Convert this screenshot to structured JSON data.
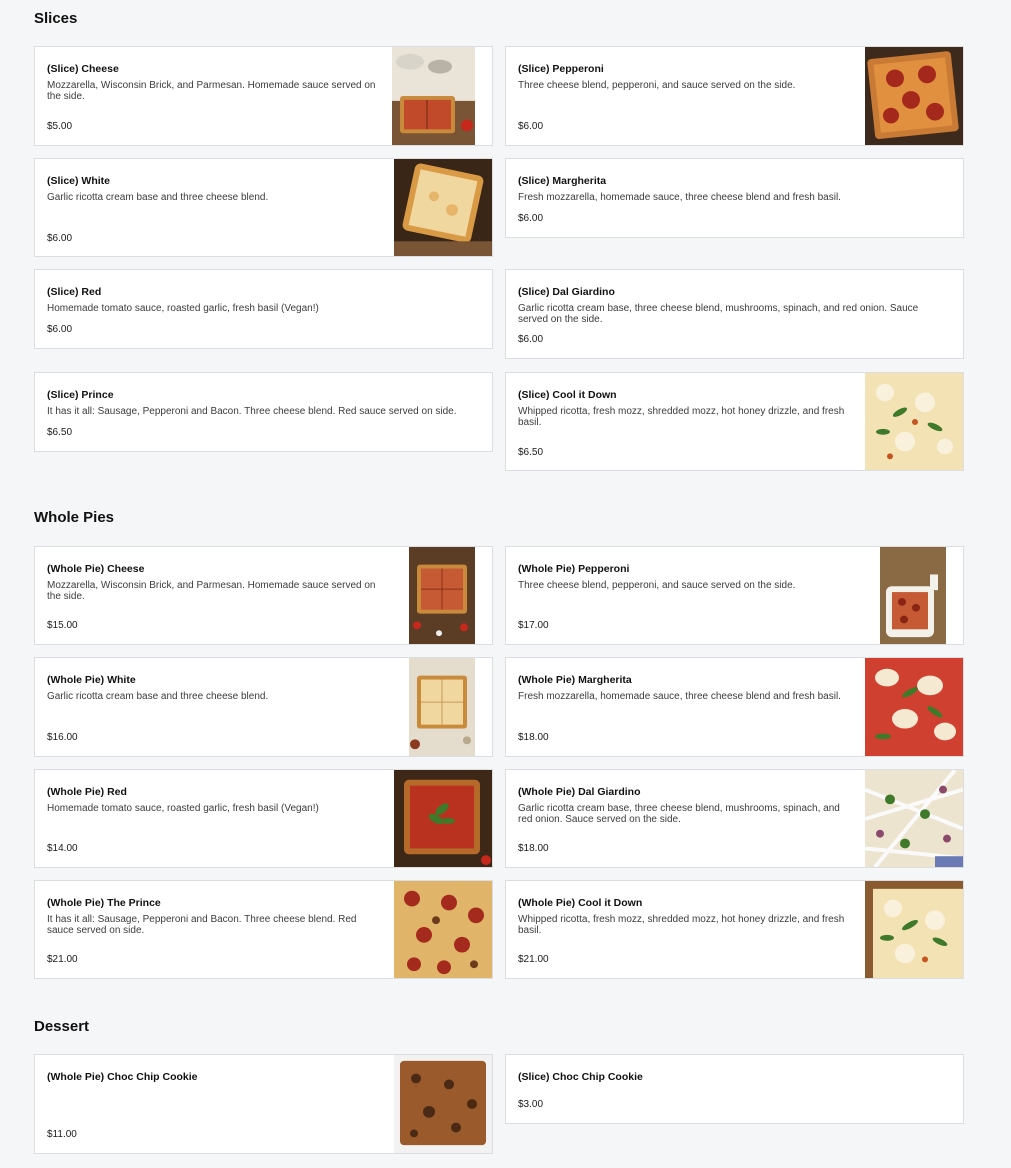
{
  "sections": {
    "slices": "Slices",
    "whole_pies": "Whole Pies",
    "dessert": "Dessert"
  },
  "items": {
    "slice_cheese": {
      "name": "(Slice) Cheese",
      "desc": "Mozzarella, Wisconsin Brick, and Parmesan. Homemade sauce served on the side.",
      "price": "$5.00",
      "photo": "cheese-slice-photo"
    },
    "slice_pepperoni": {
      "name": "(Slice) Pepperoni",
      "desc": "Three cheese blend, pepperoni, and sauce served on the side.",
      "price": "$6.00",
      "photo": "pepperoni-slice-photo"
    },
    "slice_white": {
      "name": "(Slice) White",
      "desc": "Garlic ricotta cream base and three cheese blend.",
      "price": "$6.00",
      "photo": "white-slice-photo"
    },
    "slice_margherita": {
      "name": "(Slice) Margherita",
      "desc": "Fresh mozzarella, homemade sauce, three cheese blend and fresh basil.",
      "price": "$6.00"
    },
    "slice_red": {
      "name": "(Slice) Red",
      "desc": "Homemade tomato sauce, roasted garlic, fresh basil (Vegan!)",
      "price": "$6.00"
    },
    "slice_dal_giardino": {
      "name": "(Slice) Dal Giardino",
      "desc": "Garlic ricotta cream base, three cheese blend, mushrooms, spinach, and red onion. Sauce served on the side.",
      "price": "$6.00"
    },
    "slice_prince": {
      "name": "(Slice) Prince",
      "desc": "It has it all: Sausage, Pepperoni and Bacon. Three cheese blend. Red sauce served on side.",
      "price": "$6.50"
    },
    "slice_cool_it_down": {
      "name": "(Slice) Cool it Down",
      "desc": "Whipped ricotta, fresh mozz, shredded mozz, hot honey drizzle, and fresh basil.",
      "price": "$6.50",
      "photo": "cool-it-down-slice-photo"
    },
    "pie_cheese": {
      "name": "(Whole Pie) Cheese",
      "desc": "Mozzarella, Wisconsin Brick, and Parmesan. Homemade sauce served on the side.",
      "price": "$15.00",
      "photo": "cheese-pie-photo"
    },
    "pie_pepperoni": {
      "name": "(Whole Pie) Pepperoni",
      "desc": "Three cheese blend, pepperoni, and sauce served on the side.",
      "price": "$17.00",
      "photo": "pepperoni-pie-photo"
    },
    "pie_white": {
      "name": "(Whole Pie) White",
      "desc": "Garlic ricotta cream base and three cheese blend.",
      "price": "$16.00",
      "photo": "white-pie-photo"
    },
    "pie_margherita": {
      "name": "(Whole Pie) Margherita",
      "desc": "Fresh mozzarella, homemade sauce, three cheese blend and fresh basil.",
      "price": "$18.00",
      "photo": "margherita-pie-photo"
    },
    "pie_red": {
      "name": "(Whole Pie) Red",
      "desc": "Homemade tomato sauce, roasted garlic, fresh basil (Vegan!)",
      "price": "$14.00",
      "photo": "red-pie-photo"
    },
    "pie_dal_giardino": {
      "name": "(Whole Pie) Dal Giardino",
      "desc": "Garlic ricotta cream base, three cheese blend, mushrooms, spinach, and red onion. Sauce served on the side.",
      "price": "$18.00",
      "photo": "dal-giardino-pie-photo"
    },
    "pie_the_prince": {
      "name": "(Whole Pie) The Prince",
      "desc": "It has it all: Sausage, Pepperoni and Bacon. Three cheese blend. Red sauce served on side.",
      "price": "$21.00",
      "photo": "the-prince-pie-photo"
    },
    "pie_cool_it_down": {
      "name": "(Whole Pie) Cool it Down",
      "desc": "Whipped ricotta, fresh mozz, shredded mozz, hot honey drizzle, and fresh basil.",
      "price": "$21.00",
      "photo": "cool-it-down-pie-photo"
    },
    "pie_choc_chip_cookie": {
      "name": "(Whole Pie) Choc Chip Cookie",
      "desc": "",
      "price": "$11.00",
      "photo": "choc-chip-cookie-photo"
    },
    "slice_choc_chip_cookie": {
      "name": "(Slice) Choc Chip Cookie",
      "desc": "",
      "price": "$3.00"
    }
  },
  "colors": {
    "background": "#f5f6f8",
    "card": "#ffffff",
    "border": "#dcdde0",
    "crust": "#c98a3c",
    "sauce": "#b8321f",
    "cheese": "#f1d38a",
    "basil": "#3f7a2a",
    "wood": "#6e4a2c"
  }
}
